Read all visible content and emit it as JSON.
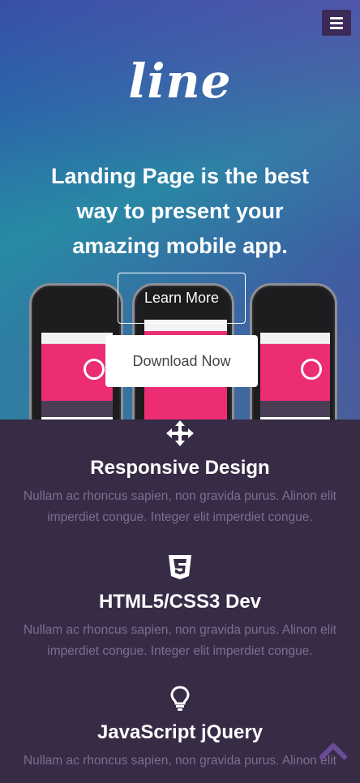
{
  "hero": {
    "logo": "line",
    "headline": "Landing Page is the best way to present your amazing mobile app.",
    "learn_more": "Learn More",
    "download_now": "Download Now"
  },
  "features": [
    {
      "icon": "move-arrows-icon",
      "title": "Responsive Design",
      "text": "Nullam ac rhoncus sapien, non gravida purus. Alinon elit imperdiet congue. Integer elit imperdiet congue."
    },
    {
      "icon": "css3-icon",
      "title": "HTML5/CSS3 Dev",
      "text": "Nullam ac rhoncus sapien, non gravida purus. Alinon elit imperdiet congue. Integer elit imperdiet congue."
    },
    {
      "icon": "lightbulb-icon",
      "title": "JavaScript jQuery",
      "text": "Nullam ac rhoncus sapien, non gravida purus. Alinon elit"
    }
  ],
  "colors": {
    "feature_bg": "#372b46",
    "feature_text": "#7c6e90",
    "accent_purple": "#6b4c9a",
    "phone_pink": "#ec2d74"
  }
}
